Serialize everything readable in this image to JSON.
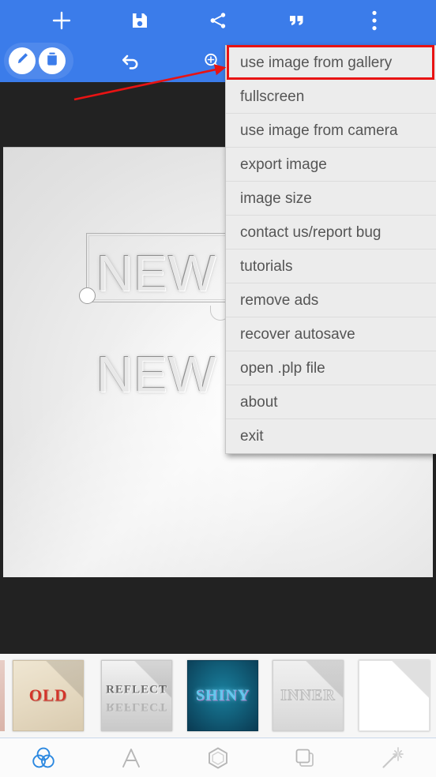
{
  "toolbar": {
    "add_label": "add",
    "add_icon": "plus-icon",
    "save_icon": "save-floppy-icon",
    "share_icon": "share-icon",
    "quote_icon": "quotation-mark-icon",
    "overflow_icon": "three-dots-vertical-icon",
    "edit_icon": "pencil-edit-icon",
    "trash_icon": "trash-delete-icon",
    "undo_icon": "undo-arrow-icon",
    "zoom_icon": "magnifier-zoom-in-icon",
    "accent_color": "#3b7cea"
  },
  "menu": {
    "items": [
      {
        "label": "use image from gallery",
        "name": "menu-item-use-image-from-gallery",
        "highlighted": true
      },
      {
        "label": "fullscreen",
        "name": "menu-item-fullscreen",
        "highlighted": false
      },
      {
        "label": "use image from camera",
        "name": "menu-item-use-image-from-camera",
        "highlighted": false
      },
      {
        "label": "export image",
        "name": "menu-item-export-image",
        "highlighted": false
      },
      {
        "label": "image size",
        "name": "menu-item-image-size",
        "highlighted": false
      },
      {
        "label": "contact us/report bug",
        "name": "menu-item-contact-us-report-bug",
        "highlighted": false
      },
      {
        "label": "tutorials",
        "name": "menu-item-tutorials",
        "highlighted": false
      },
      {
        "label": "remove ads",
        "name": "menu-item-remove-ads",
        "highlighted": false
      },
      {
        "label": "recover autosave",
        "name": "menu-item-recover-autosave",
        "highlighted": false
      },
      {
        "label": "open .plp file",
        "name": "menu-item-open-plp-file",
        "highlighted": false
      },
      {
        "label": "about",
        "name": "menu-item-about",
        "highlighted": false
      },
      {
        "label": "exit",
        "name": "menu-item-exit",
        "highlighted": false
      }
    ],
    "highlight_color": "#e81313",
    "background_color": "#ececec",
    "text_color": "#555555"
  },
  "canvas": {
    "text_layer_1": "NEW T",
    "text_layer_2": "NEW",
    "background_color": "#e4e4e4"
  },
  "filmstrip": {
    "thumbnails": [
      {
        "label": "OLD",
        "name": "thumbnail-old"
      },
      {
        "label": "REFLECT",
        "name": "thumbnail-reflect"
      },
      {
        "label": "SHINY",
        "name": "thumbnail-shiny"
      },
      {
        "label": "INNER",
        "name": "thumbnail-inner"
      },
      {
        "label": "",
        "name": "thumbnail-blank"
      }
    ]
  },
  "bottom_nav": {
    "items": [
      {
        "icon": "overlapping-circles-icon",
        "name": "nav-item-effects",
        "selected": true
      },
      {
        "icon": "letter-a-icon",
        "name": "nav-item-text",
        "selected": false
      },
      {
        "icon": "hexagon-shape-icon",
        "name": "nav-item-shapes",
        "selected": false
      },
      {
        "icon": "layers-stack-icon",
        "name": "nav-item-layers",
        "selected": false
      },
      {
        "icon": "magic-wand-icon",
        "name": "nav-item-magic",
        "selected": false
      }
    ],
    "selected_color": "#2b88e0",
    "idle_color": "#b6b6b6"
  }
}
